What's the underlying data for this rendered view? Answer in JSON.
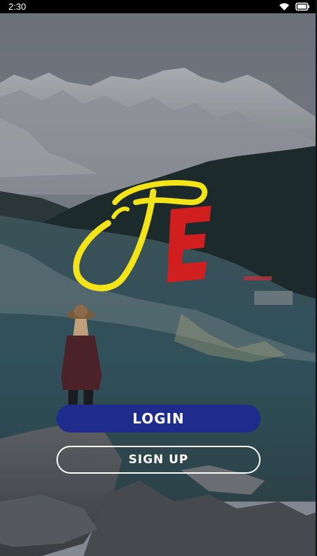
{
  "status_bar": {
    "time": "2:30",
    "icons": [
      "wifi-icon",
      "battery-icon"
    ]
  },
  "logo": {
    "letters": [
      "T",
      "E"
    ],
    "colors": {
      "t": "#f2e419",
      "e": "#d11f1f"
    }
  },
  "buttons": {
    "login_label": "LOGIN",
    "signup_label": "SIGN UP"
  },
  "colors": {
    "login_bg": "#1f2c8c",
    "signup_border": "#ffffff"
  }
}
